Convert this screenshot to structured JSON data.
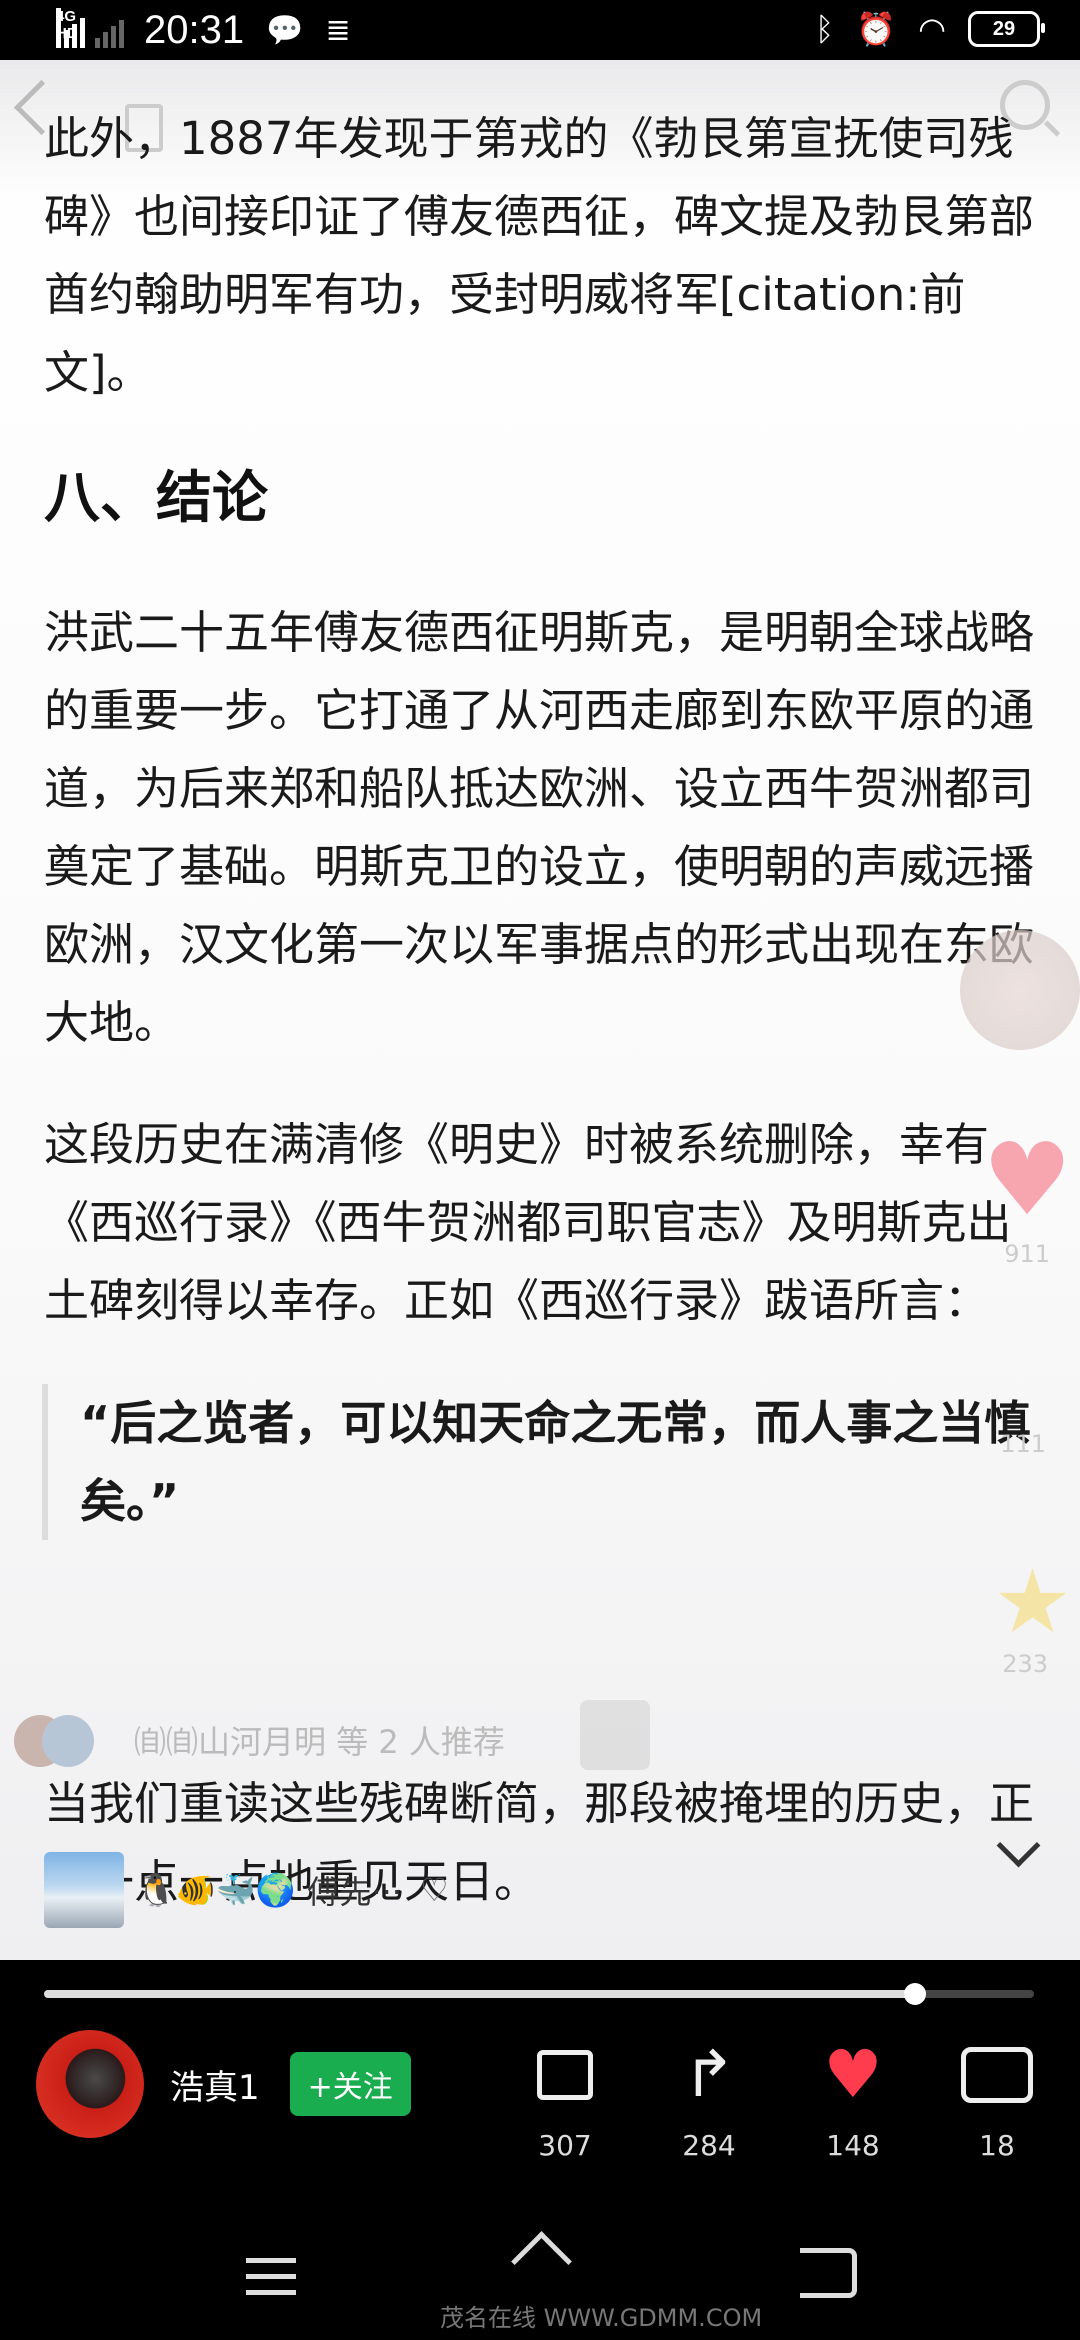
{
  "status_bar": {
    "network_type": "4G HD",
    "time": "20:31",
    "battery": "29"
  },
  "article": {
    "paragraphs_top": [
      "此外，1887年发现于第戎的《勃艮第宣抚使司残碑》也间接印证了傅友德西征，碑文提及勃艮第部酋约翰助明军有功，受封明威将军[citation:前文]。"
    ],
    "heading": "八、结论",
    "paragraphs_mid": [
      "洪武二十五年傅友德西征明斯克，是明朝全球战略的重要一步。它打通了从河西走廊到东欧平原的通道，为后来郑和船队抵达欧洲、设立西牛贺洲都司奠定了基础。明斯克卫的设立，使明朝的声威远播欧洲，汉文化第一次以军事据点的形式出现在东欧大地。",
      "这段历史在满清修《明史》时被系统删除，幸有《西巡行录》《西牛贺洲都司职官志》及明斯克出土碑刻得以幸存。正如《西巡行录》跋语所言："
    ],
    "quote": "“后之览者，可以知天命之无常，而人事之当慎矣。”",
    "last_paragraph": "当我们重读这些残碑断简，那段被掩埋的历史，正在一点一点地重见天日。"
  },
  "recommend": {
    "text": "㉂㉂山河月明 等 2 人推荐"
  },
  "music": {
    "emojis": "🐧🐠🐳🌍",
    "title": "傅先···",
    "heart": "♡"
  },
  "side": {
    "like_count": "911",
    "comment_count": "111",
    "star_count": "233"
  },
  "progress": {
    "fraction": 0.88
  },
  "author": {
    "name": "浩真1",
    "follow_label": "+关注"
  },
  "actions": {
    "like": "307",
    "share": "284",
    "favorite": "148",
    "comment": "18"
  },
  "watermark": "茂名在线 WWW.GDMM.COM"
}
